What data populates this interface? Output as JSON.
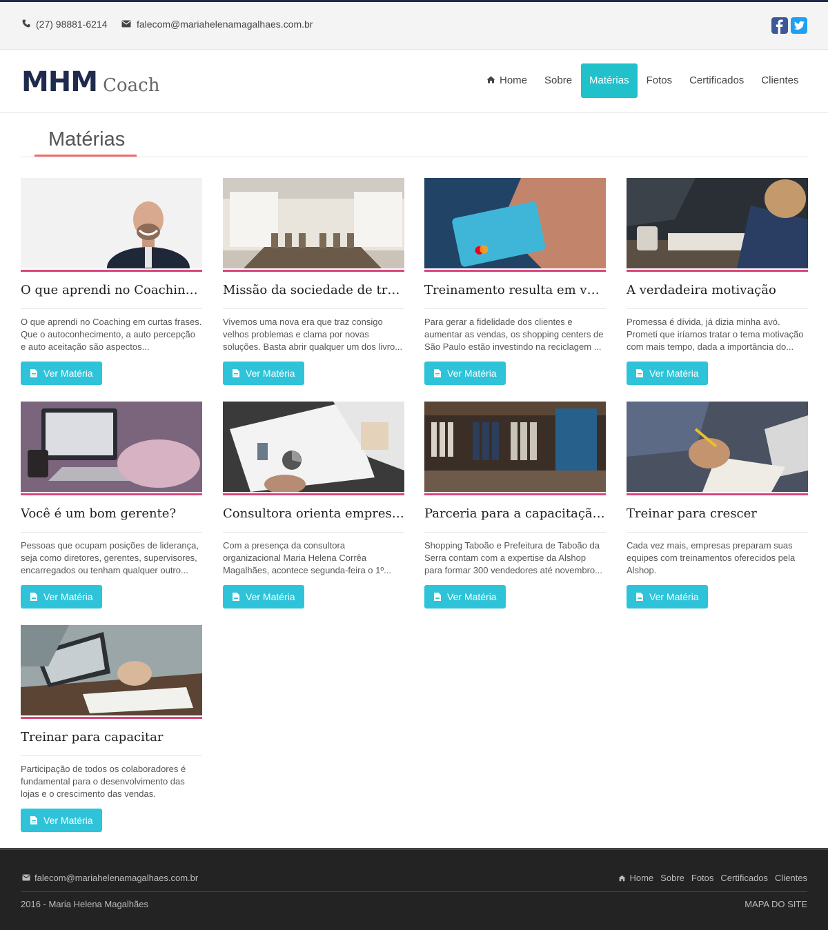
{
  "topbar": {
    "phone": "(27) 98881-6214",
    "email": "falecom@mariahelenamagalhaes.com.br",
    "social": [
      "facebook-icon",
      "twitter-icon"
    ]
  },
  "header": {
    "logo_main": "MHM",
    "logo_sub": "Coach",
    "nav": [
      "Home",
      "Sobre",
      "Matérias",
      "Fotos",
      "Certificados",
      "Clientes"
    ],
    "active": "Matérias"
  },
  "section_title": "Matérias",
  "button_label": "Ver Matéria",
  "articles": [
    {
      "title": "O que aprendi no Coaching e...",
      "text": "O que aprendi no Coaching em curtas frases. Que o autoconhecimento, a auto percepção e auto aceitação são aspectos..."
    },
    {
      "title": "Missão da sociedade de trabal...",
      "text": "Vivemos uma nova era que traz consigo velhos problemas e clama por novas soluções. Basta abrir qualquer um dos livro..."
    },
    {
      "title": "Treinamento resulta em vend...",
      "text": "Para gerar a fidelidade dos clientes e aumentar as vendas, os shopping centers de São Paulo estão investindo na reciclagem ..."
    },
    {
      "title": "A verdadeira motivação",
      "text": "Promessa é dívida, já dizia minha avó. Prometi que iríamos tratar o tema motivação com mais tempo, dada a importância do..."
    },
    {
      "title": "Você é um bom gerente?",
      "text": "Pessoas que ocupam posições de liderança, seja como diretores, gerentes, supervisores, encarregados ou tenham qualquer outro..."
    },
    {
      "title": "Consultora orienta empresári...",
      "text": "Com a presença da consultora organizacional Maria Helena Corrêa Magalhães, acontece segunda-feira o 1º..."
    },
    {
      "title": "Parceria para a capacitação d...",
      "text": "Shopping Taboão e Prefeitura de Taboão da Serra contam com a expertise da Alshop para formar 300 vendedores até novembro..."
    },
    {
      "title": "Treinar para crescer",
      "text": "Cada vez mais, empresas preparam suas equipes com treinamentos oferecidos pela Alshop."
    },
    {
      "title": "Treinar para capacitar",
      "text": "Participação de todos os colaboradores é fundamental para o desenvolvimento das lojas e o crescimento das vendas."
    }
  ],
  "footer": {
    "email": "falecom@mariahelenamagalhaes.com.br",
    "nav": [
      "Home",
      "Sobre",
      "Fotos",
      "Certificados",
      "Clientes"
    ],
    "copyright": "2016 - Maria Helena Magalhães",
    "sitemap": "MAPA DO SITE"
  },
  "colors": {
    "brand_navy": "#1f2a4d",
    "accent_teal": "#21c1cc",
    "button": "#2ec3d8",
    "image_rule": "#d9457c",
    "title_underline": "#f06c6c"
  }
}
